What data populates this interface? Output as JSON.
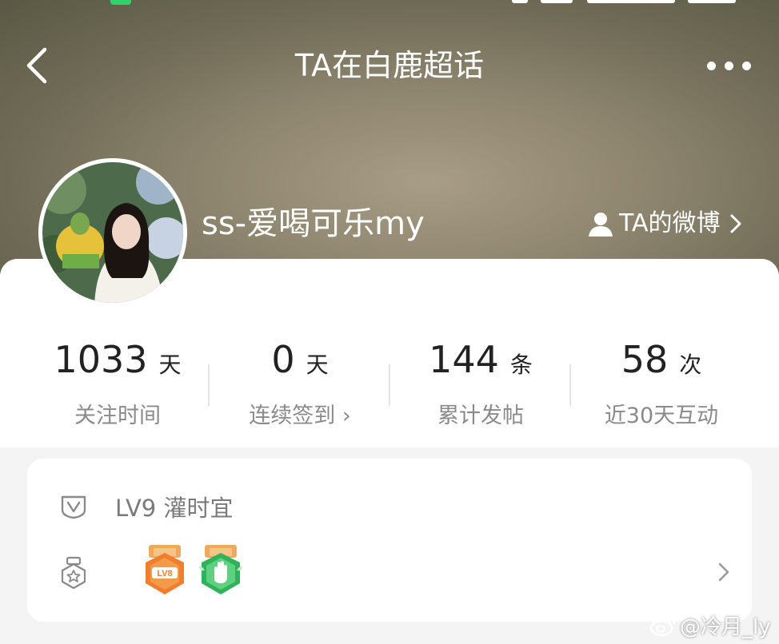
{
  "header": {
    "title": "TA在白鹿超话"
  },
  "profile": {
    "username": "ss-爱喝可乐my",
    "weibo_link_label": "TA的微博"
  },
  "stats": [
    {
      "value": "1033",
      "unit": "天",
      "label": "关注时间"
    },
    {
      "value": "0",
      "unit": "天",
      "label": "连续签到 ›"
    },
    {
      "value": "144",
      "unit": "条",
      "label": "累计发帖"
    },
    {
      "value": "58",
      "unit": "次",
      "label": "近30天互动"
    }
  ],
  "level": {
    "text": "LV9 灌时宜",
    "badges": [
      {
        "icon": "lv-badge-icon",
        "color": "#f08a34"
      },
      {
        "icon": "hand-badge-icon",
        "color": "#39c46a"
      }
    ]
  },
  "watermark": {
    "text": "@冷月_ly"
  },
  "colors": {
    "hero_bg": "#8f8670",
    "card_bg": "#ffffff",
    "stat_value": "#222222",
    "stat_label": "#8a8a8a"
  }
}
